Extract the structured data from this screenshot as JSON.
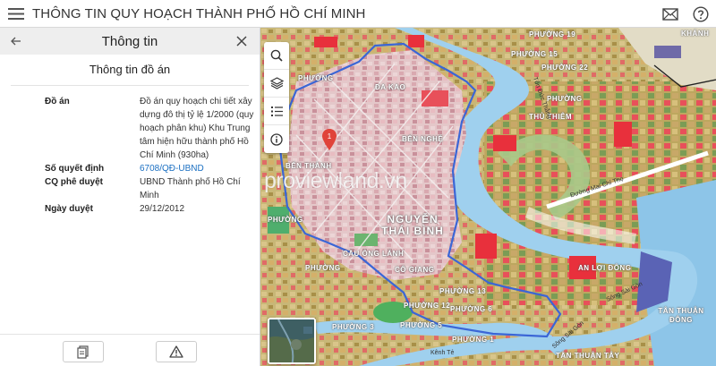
{
  "header": {
    "title": "THÔNG TIN QUY HOẠCH THÀNH PHỐ HỒ CHÍ MINH",
    "icons": [
      "menu-icon",
      "mail-icon",
      "help-icon"
    ]
  },
  "panel": {
    "title": "Thông tin",
    "section_title": "Thông tin đồ án",
    "rows": [
      {
        "label": "Đồ án",
        "value": "Đồ án quy hoạch chi tiết xây dựng đô thị tỷ lệ 1/2000 (quy hoạch phân khu) Khu Trung tâm hiện hữu thành phố Hồ Chí Minh (930ha)"
      },
      {
        "label": "Số quyết định",
        "value": "6708/QĐ-UBND"
      },
      {
        "label": "CQ phê duyệt",
        "value": "UBND Thành phố Hồ Chí Minh"
      },
      {
        "label": "Ngày duyệt",
        "value": "29/12/2012"
      }
    ],
    "footer_icons": [
      "document-icon",
      "warning-icon"
    ]
  },
  "map": {
    "watermark": "proviewland.vn",
    "pin_label": "1",
    "labels": {
      "khanh": "KHÁNH",
      "phuong_top": "PHƯỜNG",
      "dakao": "ĐA KAO",
      "ben_nghe": "BẾN NGHÉ",
      "ben_thanh": "BẾN THÀNH",
      "nguyen_thai_binh": "NGUYỄN THÁI BÌNH",
      "phuong_left": "PHƯỜNG",
      "phuong_left2": "PHƯỜNG",
      "cau_ong_lanh": "CẦU ÔNG LÃNH",
      "co_giang": "CÔ GIANG",
      "phuong_13": "PHƯỜNG 13",
      "phuong_12": "PHƯỜNG 12",
      "phuong_6": "PHƯỜNG 6",
      "phuong_5": "PHƯỜNG 5",
      "phuong_1": "PHƯỜNG 1",
      "phuong_3": "PHƯỜNG 3",
      "phuong_22": "PHƯỜNG 22",
      "phuong_19": "PHƯỜNG 19",
      "phuong_15": "PHƯỜNG 15",
      "an_loi_dong": "AN LỢI ĐÔNG",
      "tan_thuan_dong": "TÂN THUẬN ĐÔNG",
      "tan_thuan_tay": "TÂN THUẬN TÂY",
      "thu_thiem": "THỦ THIÊM",
      "da_kao_lbl": "PHƯỜNG"
    },
    "roads": {
      "mai_chi_tho": "Đường Mai Chí Thọ",
      "song_sai_gon": "Sông Sài Gòn",
      "ton_duc_thang": "Tôn Đức Thắng",
      "kenh_te": "Kênh Tẻ",
      "cau_kenh": "Sông Sài Gòn"
    },
    "tools": [
      "search-icon",
      "layers-icon",
      "legend-list-icon",
      "info-icon"
    ]
  }
}
